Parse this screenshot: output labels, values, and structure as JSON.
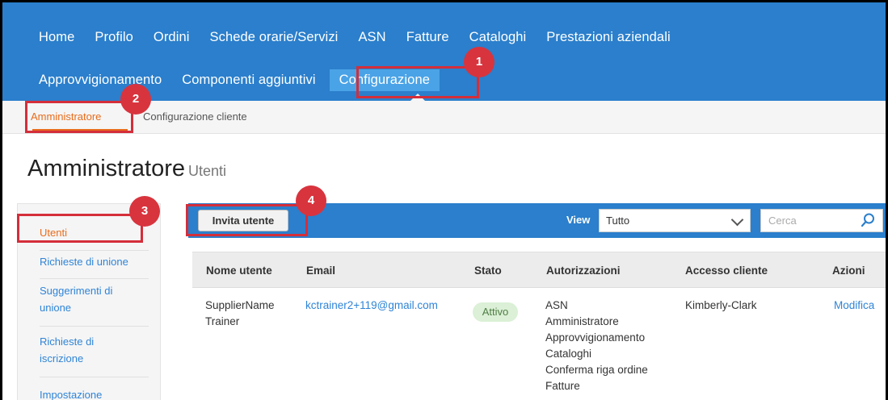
{
  "nav": {
    "row1": [
      "Home",
      "Profilo",
      "Ordini",
      "Schede orarie/Servizi",
      "ASN",
      "Fatture",
      "Cataloghi",
      "Prestazioni aziendali"
    ],
    "row2": [
      "Approvvigionamento",
      "Componenti aggiuntivi"
    ],
    "active": "Configurazione"
  },
  "subnav": {
    "active": "Amministratore",
    "other": "Configurazione cliente"
  },
  "page": {
    "title": "Amministratore",
    "subtitle": "Utenti"
  },
  "sidebar": {
    "items": [
      {
        "label_lines": [
          "Utenti"
        ],
        "active": true
      },
      {
        "label_lines": [
          "Richieste di unione"
        ]
      },
      {
        "label_lines": [
          "Suggerimenti di",
          "unione"
        ]
      },
      {
        "label_lines": [
          "Richieste di",
          "iscrizione"
        ]
      },
      {
        "label_lines": [
          "Impostazione"
        ]
      }
    ]
  },
  "toolbar": {
    "invite_label": "Invita utente",
    "view_label": "View",
    "view_value": "Tutto",
    "search_placeholder": "Cerca"
  },
  "table": {
    "headers": [
      "Nome utente",
      "Email",
      "Stato",
      "Autorizzazioni",
      "Accesso cliente",
      "Azioni"
    ],
    "row": {
      "name_lines": [
        "SupplierName",
        "Trainer"
      ],
      "email": "kctrainer2+119@gmail.com",
      "status": "Attivo",
      "permissions": [
        "ASN",
        "Amministratore",
        "Approvvigionamento",
        "Cataloghi",
        "Conferma riga ordine",
        "Fatture"
      ],
      "customer_access": "Kimberly-Clark",
      "action": "Modifica"
    }
  },
  "annotations": [
    "1",
    "2",
    "3",
    "4"
  ],
  "colors": {
    "nav_blue": "#2b7fcc",
    "active_tab": "#4aa3e6",
    "accent_orange": "#e86c1c",
    "link_blue": "#2f84d6",
    "annotation_red": "#d8343e",
    "status_green_bg": "#dbf0d6"
  }
}
